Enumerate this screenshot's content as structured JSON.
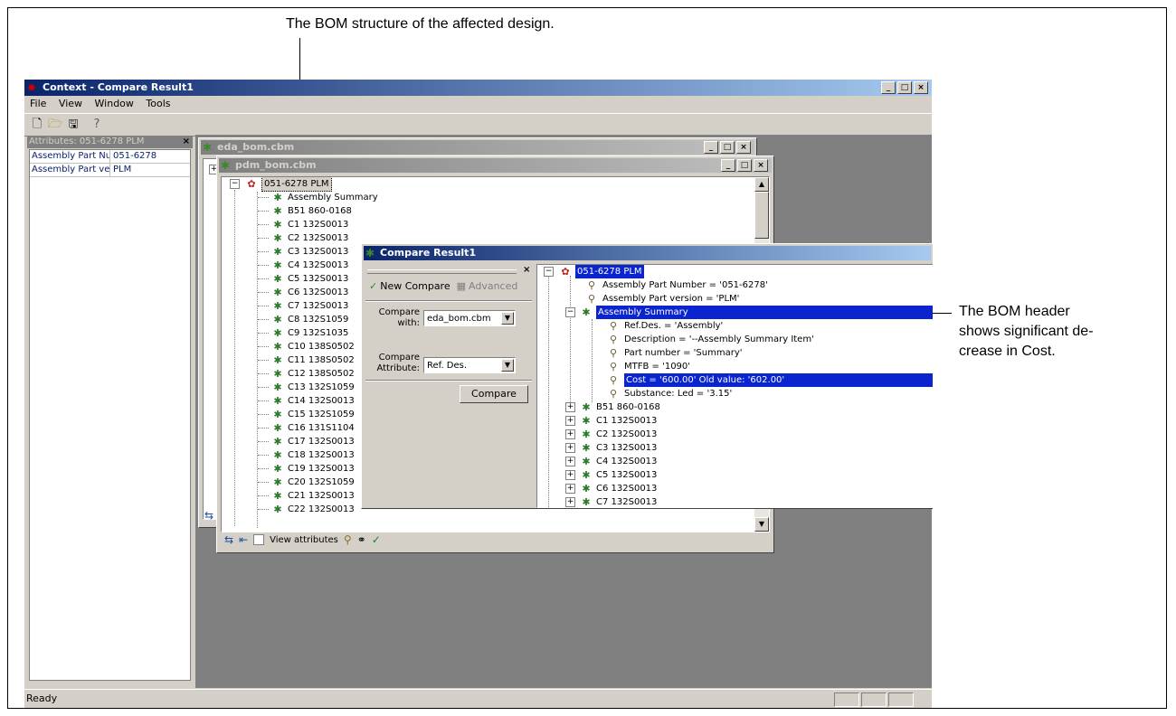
{
  "annotations": {
    "top": "The BOM structure of the affected design.",
    "right_lines": [
      "The BOM header",
      "shows significant de-",
      "crease in Cost."
    ]
  },
  "app": {
    "title": "Context - Compare Result1",
    "menu": [
      "File",
      "View",
      "Window",
      "Tools"
    ],
    "toolbar_icons": [
      "new-icon",
      "open-icon",
      "save-icon",
      "help-icon"
    ],
    "window_buttons": [
      "_",
      "□",
      "×"
    ],
    "status": "Ready"
  },
  "attributes_panel": {
    "title": "Attributes: 051-6278  PLM",
    "close": "×",
    "rows": [
      {
        "key": "Assembly Part Nu",
        "value": "051-6278"
      },
      {
        "key": "Assembly Part ve",
        "value": "PLM"
      }
    ]
  },
  "eda_window": {
    "title": "eda_bom.cbm"
  },
  "pdm_window": {
    "title": "pdm_bom.cbm",
    "root": "051-6278  PLM",
    "items": [
      "Assembly Summary",
      "B51 860-0168",
      "C1 132S0013",
      "C2 132S0013",
      "C3 132S0013",
      "C4 132S0013",
      "C5 132S0013",
      "C6 132S0013",
      "C7 132S0013",
      "C8 132S1059",
      "C9 132S1035",
      "C10 138S0502",
      "C11 138S0502",
      "C12 138S0502",
      "C13 132S1059",
      "C14 132S0013",
      "C15 132S1059",
      "C16 131S1104",
      "C17 132S0013",
      "C18 132S0013",
      "C19 132S0013",
      "C20 132S1059",
      "C21 132S0013",
      "C22 132S0013"
    ],
    "view_attributes_label": "View attributes"
  },
  "compare_window": {
    "title": "Compare Result1",
    "close": "×",
    "new_compare_label": "New Compare",
    "advanced_label": "Advanced",
    "compare_with_label": [
      "Compare",
      "with:"
    ],
    "compare_with_value": "eda_bom.cbm",
    "compare_attr_label": [
      "Compare",
      "Attribute:"
    ],
    "compare_attr_value": "Ref. Des.",
    "compare_button": "Compare",
    "tree": {
      "root": "051-6278  PLM",
      "root_attrs": [
        "Assembly Part Number = '051-6278'",
        "Assembly Part version = 'PLM'"
      ],
      "summary": "Assembly Summary",
      "summary_attrs": [
        "Ref.Des. = 'Assembly'",
        "Description = '--Assembly Summary Item'",
        "Part number = 'Summary'",
        "MTFB = '1090'",
        "Cost = '600.00' Old value: '602.00'",
        "Substance: Led = '3.15'"
      ],
      "highlighted_index": 4,
      "items": [
        "B51 860-0168",
        "C1 132S0013",
        "C2 132S0013",
        "C3 132S0013",
        "C4 132S0013",
        "C5 132S0013",
        "C6 132S0013"
      ],
      "partial_item": "C7 132S0013"
    }
  }
}
